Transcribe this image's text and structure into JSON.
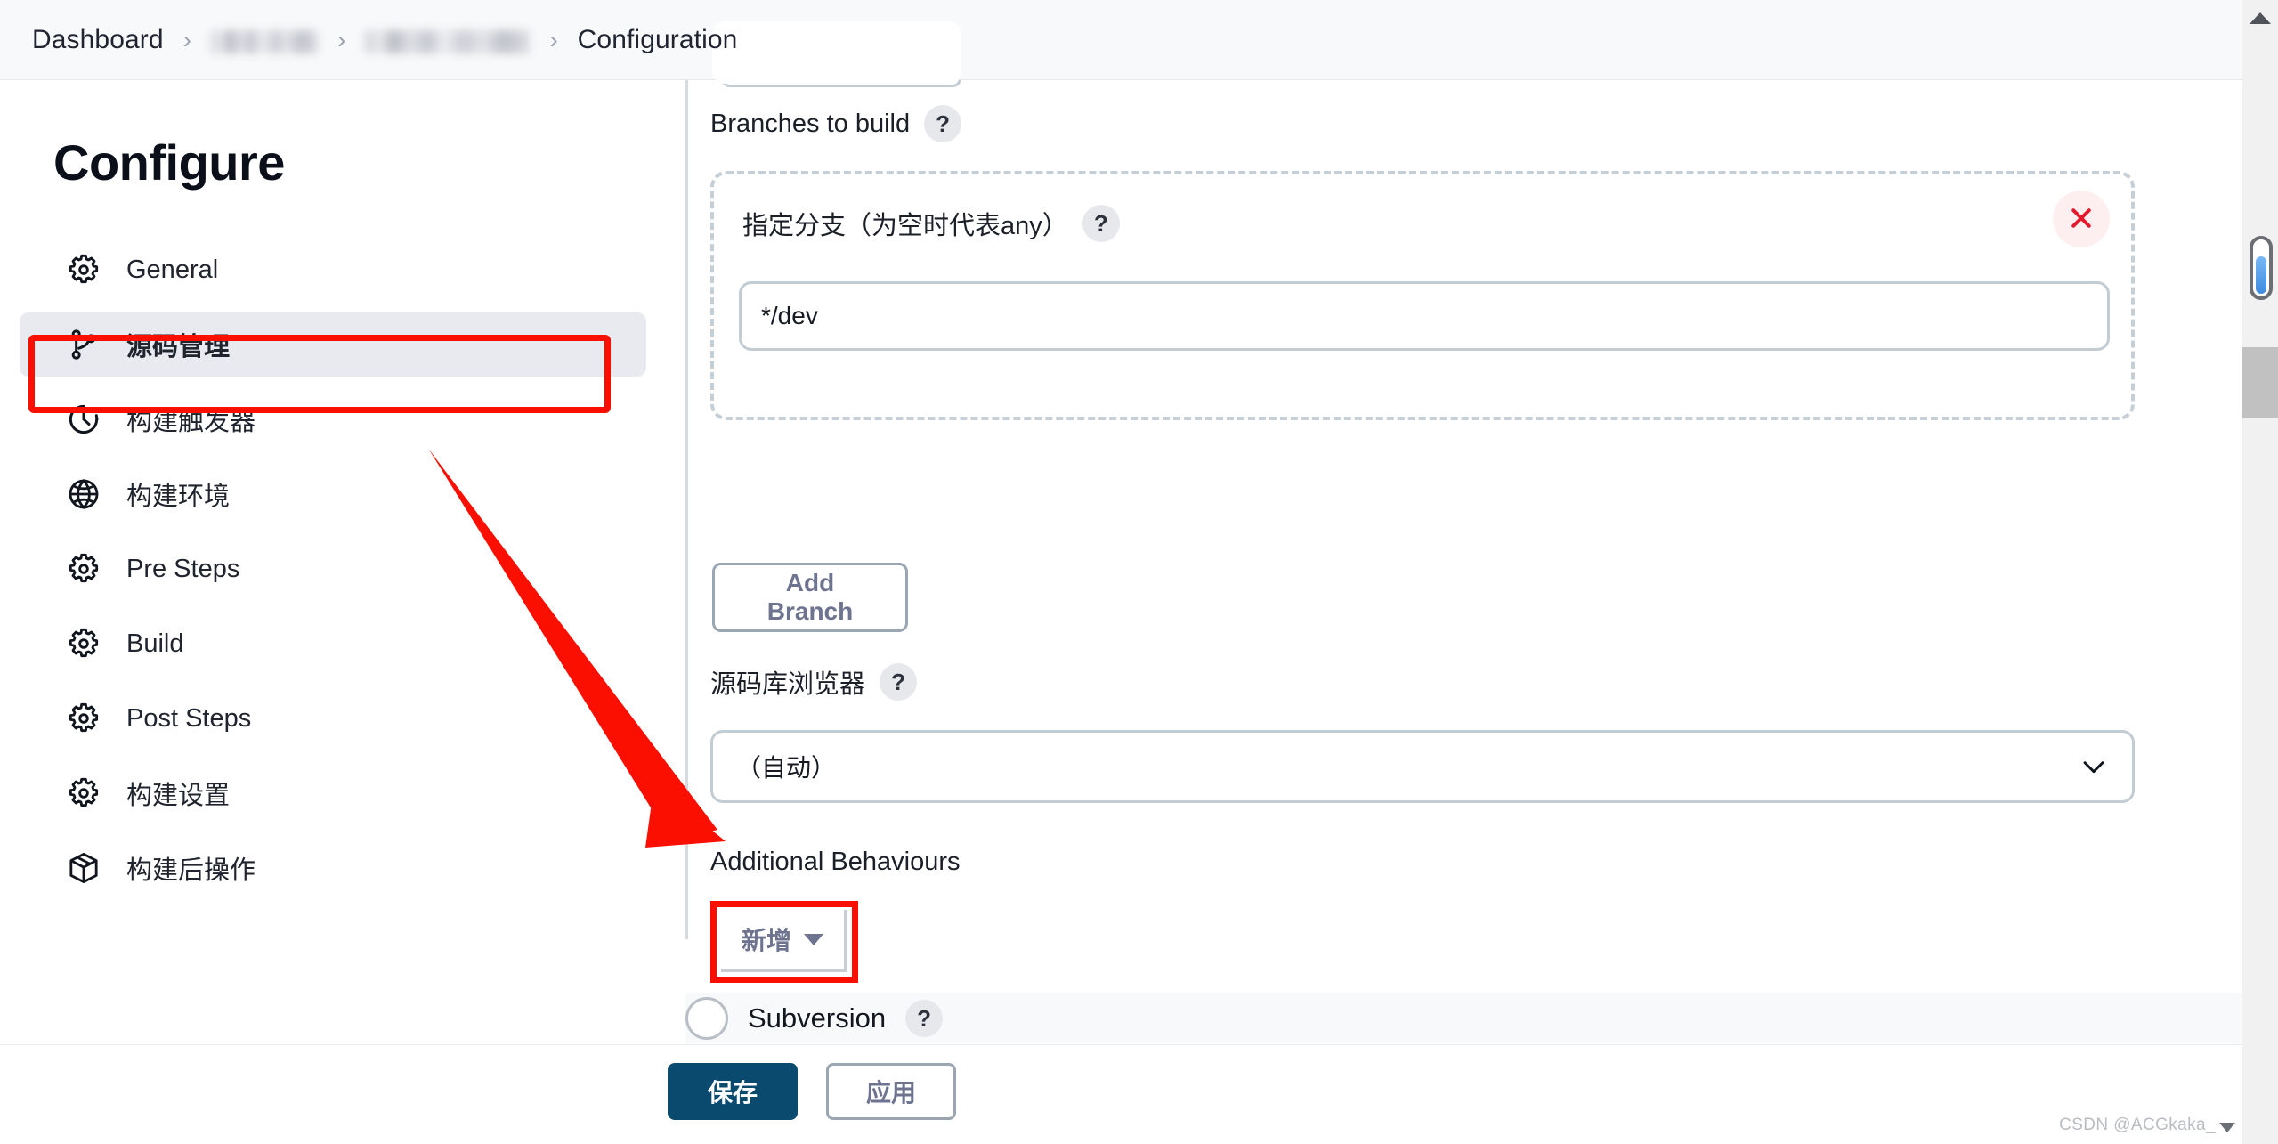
{
  "breadcrumb": {
    "items": [
      {
        "label": "Dashboard",
        "redacted": false
      },
      {
        "label": "",
        "redacted": true
      },
      {
        "label": "",
        "redacted": true
      },
      {
        "label": "Configuration",
        "redacted": false
      }
    ],
    "separator": "›"
  },
  "sidebar": {
    "title": "Configure",
    "items": [
      {
        "label": "General",
        "icon": "gear-icon",
        "active": false
      },
      {
        "label": "源码管理",
        "icon": "git-branch-icon",
        "active": true
      },
      {
        "label": "构建触发器",
        "icon": "clock-icon",
        "active": false
      },
      {
        "label": "构建环境",
        "icon": "globe-icon",
        "active": false
      },
      {
        "label": "Pre Steps",
        "icon": "gear-icon",
        "active": false
      },
      {
        "label": "Build",
        "icon": "gear-icon",
        "active": false
      },
      {
        "label": "Post Steps",
        "icon": "gear-icon",
        "active": false
      },
      {
        "label": "构建设置",
        "icon": "gear-icon",
        "active": false
      },
      {
        "label": "构建后操作",
        "icon": "package-icon",
        "active": false
      }
    ]
  },
  "main": {
    "branches_to_build": {
      "label": "Branches to build",
      "help": "?",
      "branch_specifier": {
        "label": "指定分支（为空时代表any）",
        "help": "?",
        "value": "*/dev",
        "placeholder": "",
        "remove_icon": "close-icon"
      },
      "add_branch_label": "Add Branch"
    },
    "repository_browser": {
      "label": "源码库浏览器",
      "help": "?",
      "selected": "（自动）",
      "chevron_icon": "chevron-down-icon"
    },
    "additional_behaviours": {
      "label": "Additional Behaviours",
      "add_label": "新增",
      "caret_icon": "caret-down-icon"
    },
    "subversion": {
      "label": "Subversion",
      "help": "?",
      "selected": false
    }
  },
  "footer": {
    "save_label": "保存",
    "apply_label": "应用"
  },
  "scrollbar": {
    "up_icon": "scroll-up-arrow-icon"
  },
  "watermark": {
    "text": "CSDN @ACGkaka_"
  },
  "colors": {
    "annotation_red": "#fb0f00",
    "save_blue": "#0b4a6f",
    "active_nav_bg": "#e8eaef",
    "remove_red": "#e3192e"
  }
}
